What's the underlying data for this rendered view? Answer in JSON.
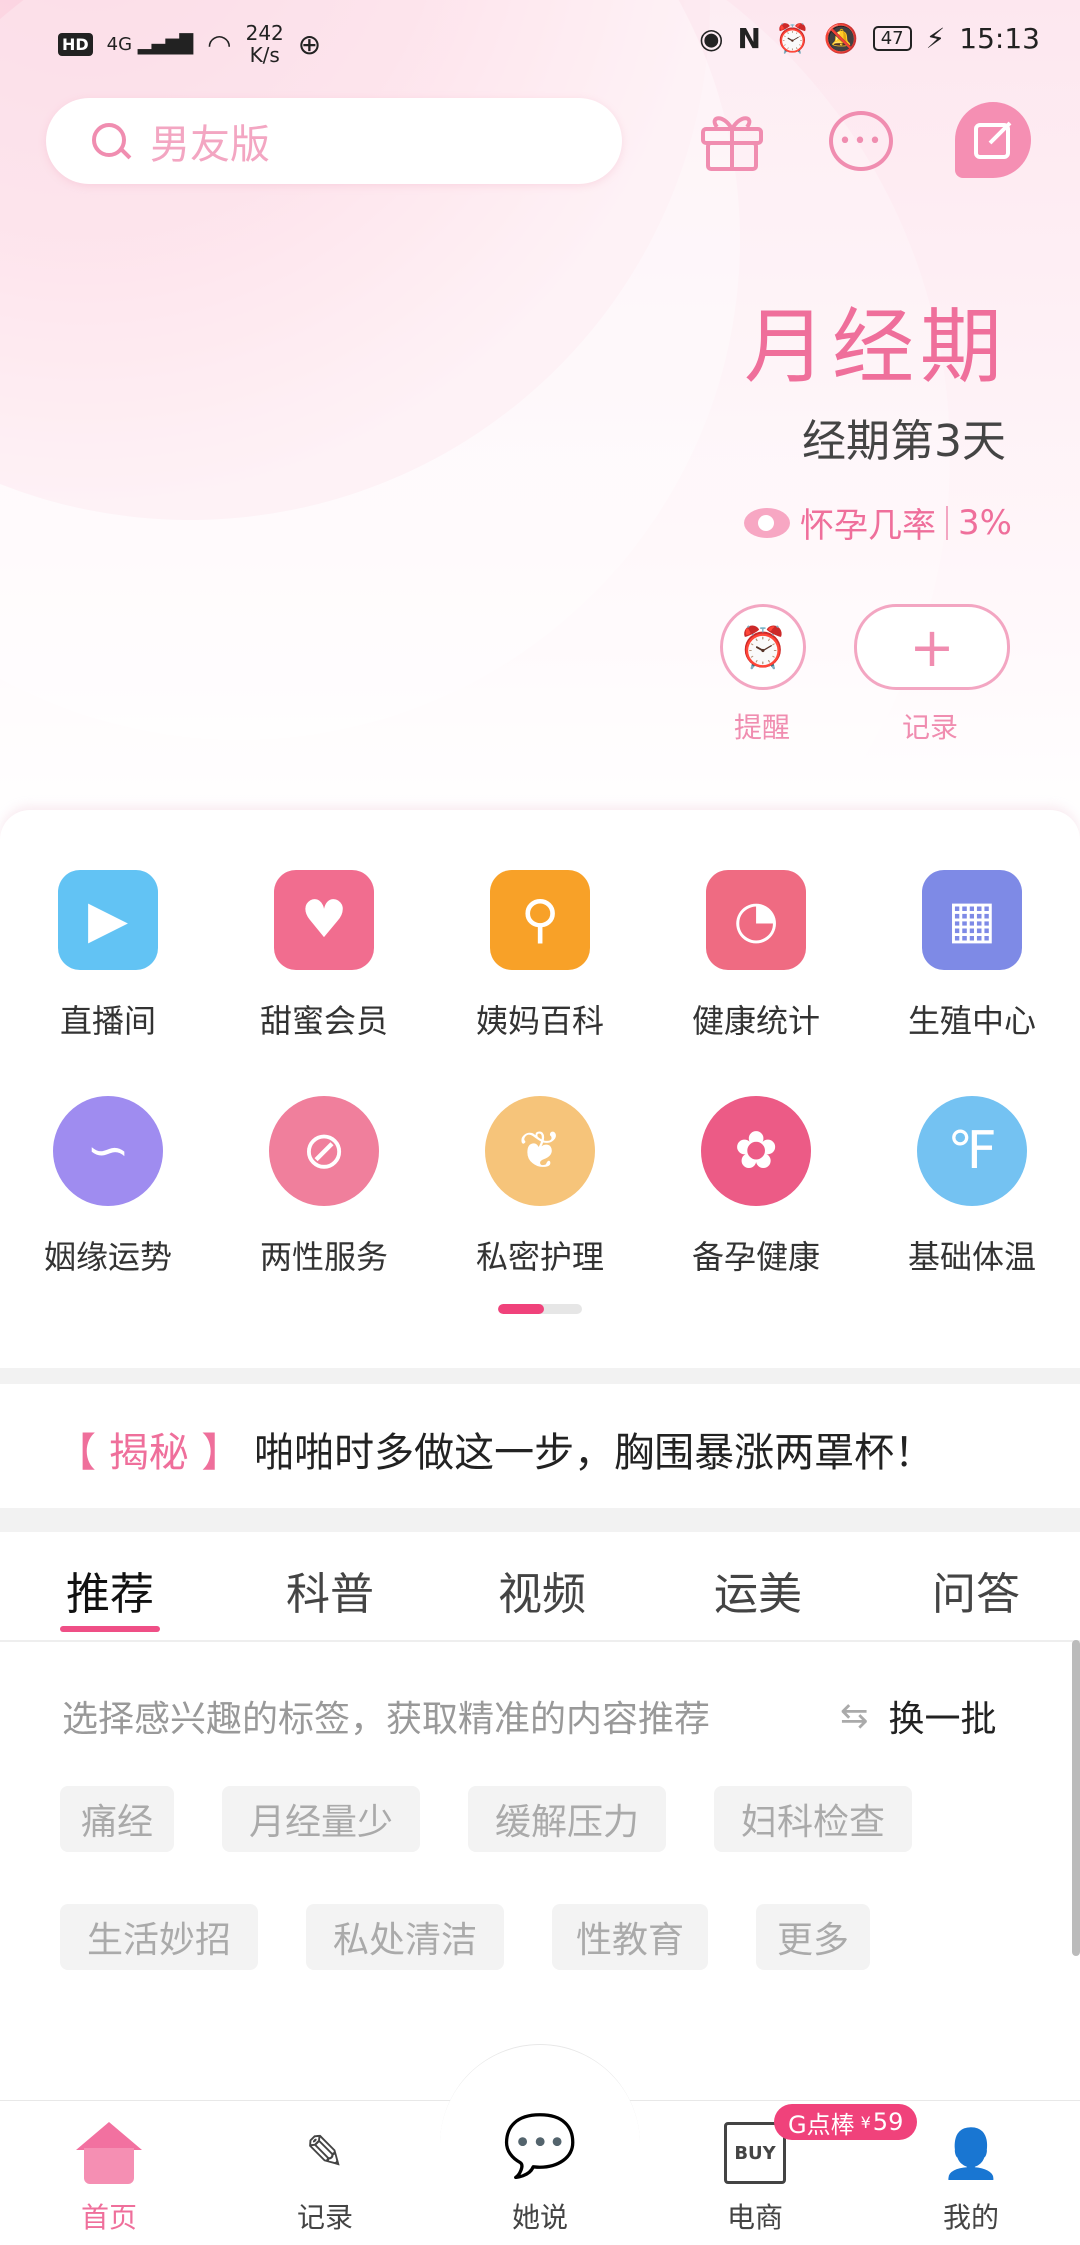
{
  "status_bar": {
    "hd": "HD",
    "signal": "4G",
    "speed_top": "242",
    "speed_unit": "K/s",
    "battery": "47",
    "time": "15:13"
  },
  "search": {
    "placeholder": "男友版"
  },
  "cycle": {
    "phase": "月经期",
    "day": "经期第3天",
    "pregnancy_label": "怀孕几率",
    "pregnancy_value": "3%"
  },
  "actions": {
    "remind_label": "提醒",
    "record_label": "记录",
    "record_symbol": "+"
  },
  "grid": [
    {
      "label": "直播间",
      "icon": "video-camera-icon",
      "color": "#62c3f4"
    },
    {
      "label": "甜蜜会员",
      "icon": "heart-box-icon",
      "color": "#f16d8f"
    },
    {
      "label": "姨妈百科",
      "icon": "search-magnifier-icon",
      "color": "#f8a128"
    },
    {
      "label": "健康统计",
      "icon": "calendar-chart-icon",
      "color": "#ef6b82"
    },
    {
      "label": "生殖中心",
      "icon": "building-icon",
      "color": "#7e8ae6"
    },
    {
      "label": "姻缘运势",
      "icon": "fish-icon",
      "color": "#9f8cf0"
    },
    {
      "label": "两性服务",
      "icon": "pill-icon",
      "color": "#f07f9c"
    },
    {
      "label": "私密护理",
      "icon": "peach-icon",
      "color": "#f6c47a"
    },
    {
      "label": "备孕健康",
      "icon": "brand-logo-icon",
      "color": "#ec5b86"
    },
    {
      "label": "基础体温",
      "icon": "thermometer-icon",
      "color": "#74c2f2"
    }
  ],
  "news": {
    "tag": "【 揭秘 】",
    "text": "啪啪时多做这一步，胸围暴涨两罩杯！"
  },
  "tabs": [
    "推荐",
    "科普",
    "视频",
    "运美",
    "问答"
  ],
  "recommend": {
    "hint": "选择感兴趣的标签，获取精准的内容推荐",
    "swap_label": "换一批",
    "chips": [
      "痛经",
      "月经量少",
      "缓解压力",
      "妇科检查",
      "生活妙招",
      "私处清洁",
      "性教育",
      "更多"
    ]
  },
  "bottom_nav": [
    {
      "label": "首页",
      "icon": "home-icon"
    },
    {
      "label": "记录",
      "icon": "pencil-icon"
    },
    {
      "label": "她说",
      "icon": "chat-bubbles-icon"
    },
    {
      "label": "电商",
      "icon": "buy-bag-icon"
    },
    {
      "label": "我的",
      "icon": "person-icon"
    }
  ],
  "promo_badge": {
    "brand": "G点棒",
    "currency": "¥",
    "price": "59"
  },
  "colors": {
    "accent": "#ef6f9b",
    "active_tab": "#ef4f86",
    "badge": "#f0427b"
  }
}
